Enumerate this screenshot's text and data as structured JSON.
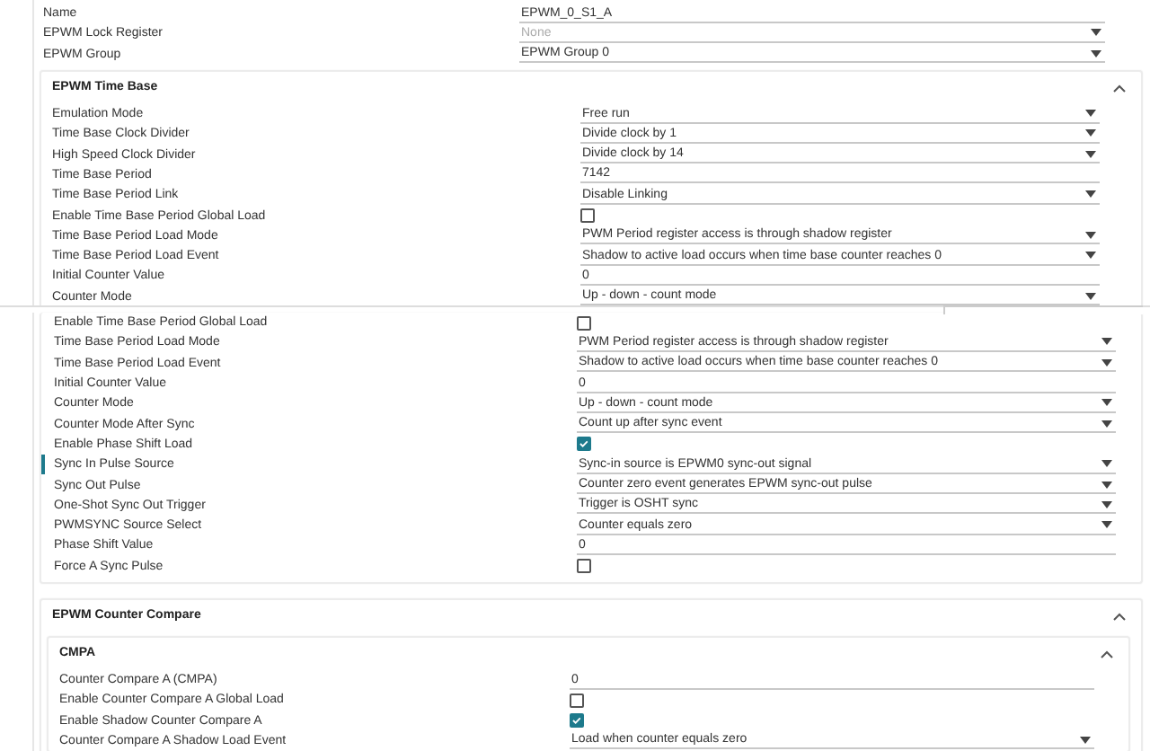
{
  "header_rows": [
    {
      "label": "Name",
      "kind": "text",
      "value": "EPWM_0_S1_A"
    },
    {
      "label": "EPWM Lock Register",
      "kind": "select",
      "placeholder": "None"
    },
    {
      "label": "EPWM Group",
      "kind": "select",
      "value": "EPWM Group 0"
    }
  ],
  "time_base": {
    "title": "EPWM Time Base",
    "expanded": true,
    "rows": [
      {
        "label": "Emulation Mode",
        "kind": "select",
        "value": "Free run"
      },
      {
        "label": "Time Base Clock Divider",
        "kind": "select",
        "value": "Divide clock by 1"
      },
      {
        "label": "High Speed Clock Divider",
        "kind": "select",
        "value": "Divide clock by 14"
      },
      {
        "label": "Time Base Period",
        "kind": "text",
        "value": "7142"
      },
      {
        "label": "Time Base Period Link",
        "kind": "select",
        "value": "Disable Linking"
      },
      {
        "label": "Enable Time Base Period Global Load",
        "kind": "checkbox",
        "checked": false
      },
      {
        "label": "Time Base Period Load Mode",
        "kind": "select",
        "value": "PWM Period register access is through shadow register"
      },
      {
        "label": "Time Base Period Load Event",
        "kind": "select",
        "value": "Shadow to active load occurs when time base counter reaches 0"
      },
      {
        "label": "Initial Counter Value",
        "kind": "text",
        "value": "0"
      },
      {
        "label": "Counter Mode",
        "kind": "select",
        "value": "Up - down - count mode"
      }
    ]
  },
  "time_base_continued": {
    "rows": [
      {
        "label": "Enable Time Base Period Global Load",
        "kind": "checkbox",
        "checked": false,
        "selected": false
      },
      {
        "label": "Time Base Period Load Mode",
        "kind": "select",
        "value": "PWM Period register access is through shadow register",
        "selected": false
      },
      {
        "label": "Time Base Period Load Event",
        "kind": "select",
        "value": "Shadow to active load occurs when time base counter reaches 0",
        "selected": false
      },
      {
        "label": "Initial Counter Value",
        "kind": "text",
        "value": "0",
        "selected": false
      },
      {
        "label": "Counter Mode",
        "kind": "select",
        "value": "Up - down - count mode",
        "selected": false
      },
      {
        "label": "Counter Mode After Sync",
        "kind": "select",
        "value": "Count up after sync event",
        "selected": false
      },
      {
        "label": "Enable Phase Shift Load",
        "kind": "checkbox",
        "checked": true,
        "selected": false
      },
      {
        "label": "Sync In Pulse Source",
        "kind": "select",
        "value": "Sync-in source is EPWM0 sync-out signal",
        "selected": true
      },
      {
        "label": "Sync Out Pulse",
        "kind": "select",
        "value": "Counter zero event generates EPWM sync-out pulse",
        "selected": false
      },
      {
        "label": "One-Shot Sync Out Trigger",
        "kind": "select",
        "value": "Trigger is OSHT sync",
        "selected": false
      },
      {
        "label": "PWMSYNC Source Select",
        "kind": "select",
        "value": "Counter equals zero",
        "selected": false
      },
      {
        "label": "Phase Shift Value",
        "kind": "text",
        "value": "0",
        "selected": false
      },
      {
        "label": "Force A Sync Pulse",
        "kind": "checkbox",
        "checked": false,
        "selected": false
      }
    ]
  },
  "counter_compare": {
    "title": "EPWM Counter Compare",
    "expanded": true,
    "subsections": [
      {
        "title": "CMPA",
        "expanded": true,
        "rows": [
          {
            "label": "Counter Compare A (CMPA)",
            "kind": "text",
            "value": "0"
          },
          {
            "label": "Enable Counter Compare A Global Load",
            "kind": "checkbox",
            "checked": false
          },
          {
            "label": "Enable Shadow Counter Compare A",
            "kind": "checkbox",
            "checked": true
          },
          {
            "label": "Counter Compare A Shadow Load Event",
            "kind": "select",
            "value": "Load when counter equals zero"
          }
        ]
      }
    ]
  }
}
